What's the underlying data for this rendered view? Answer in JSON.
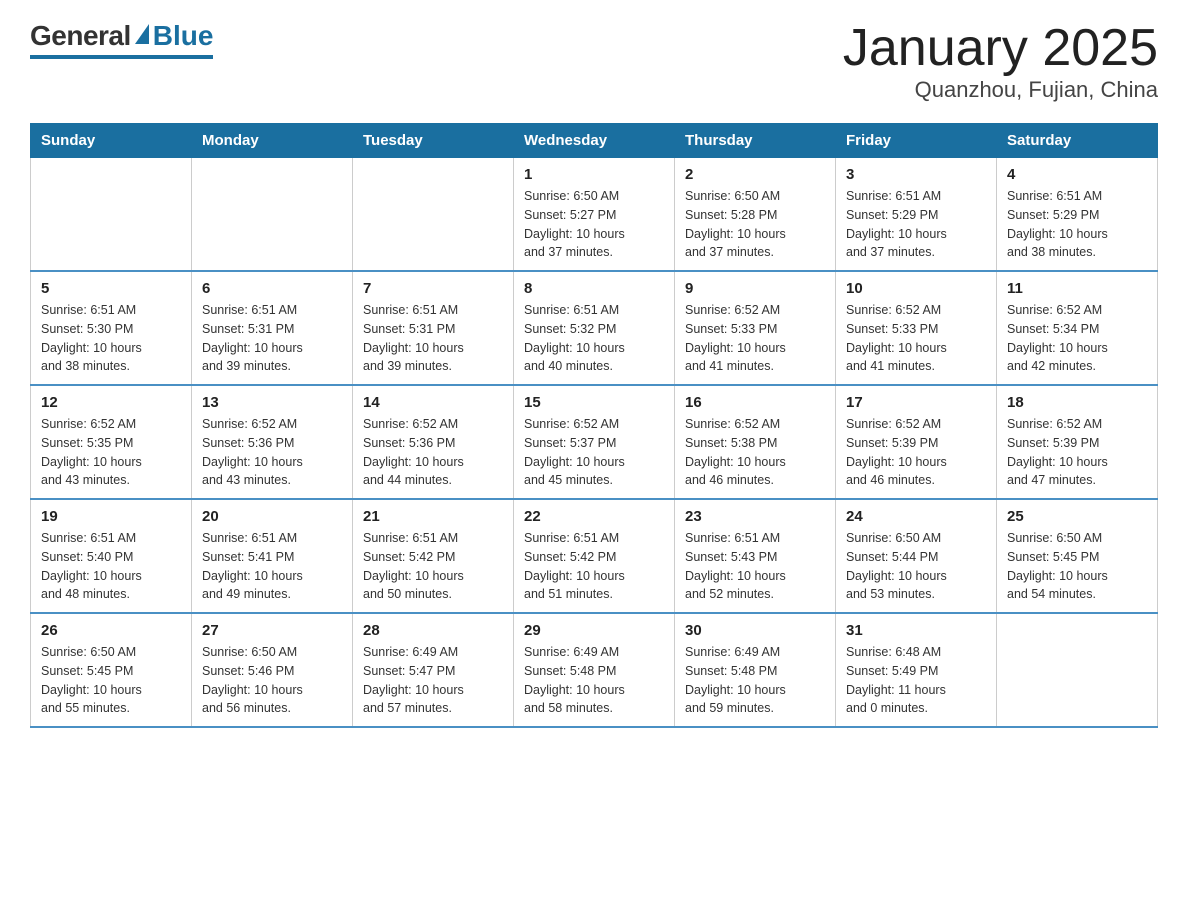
{
  "logo": {
    "general": "General",
    "blue": "Blue",
    "subtitle": "Blue"
  },
  "title": "January 2025",
  "location": "Quanzhou, Fujian, China",
  "weekdays": [
    "Sunday",
    "Monday",
    "Tuesday",
    "Wednesday",
    "Thursday",
    "Friday",
    "Saturday"
  ],
  "weeks": [
    [
      {
        "day": "",
        "info": ""
      },
      {
        "day": "",
        "info": ""
      },
      {
        "day": "",
        "info": ""
      },
      {
        "day": "1",
        "info": "Sunrise: 6:50 AM\nSunset: 5:27 PM\nDaylight: 10 hours\nand 37 minutes."
      },
      {
        "day": "2",
        "info": "Sunrise: 6:50 AM\nSunset: 5:28 PM\nDaylight: 10 hours\nand 37 minutes."
      },
      {
        "day": "3",
        "info": "Sunrise: 6:51 AM\nSunset: 5:29 PM\nDaylight: 10 hours\nand 37 minutes."
      },
      {
        "day": "4",
        "info": "Sunrise: 6:51 AM\nSunset: 5:29 PM\nDaylight: 10 hours\nand 38 minutes."
      }
    ],
    [
      {
        "day": "5",
        "info": "Sunrise: 6:51 AM\nSunset: 5:30 PM\nDaylight: 10 hours\nand 38 minutes."
      },
      {
        "day": "6",
        "info": "Sunrise: 6:51 AM\nSunset: 5:31 PM\nDaylight: 10 hours\nand 39 minutes."
      },
      {
        "day": "7",
        "info": "Sunrise: 6:51 AM\nSunset: 5:31 PM\nDaylight: 10 hours\nand 39 minutes."
      },
      {
        "day": "8",
        "info": "Sunrise: 6:51 AM\nSunset: 5:32 PM\nDaylight: 10 hours\nand 40 minutes."
      },
      {
        "day": "9",
        "info": "Sunrise: 6:52 AM\nSunset: 5:33 PM\nDaylight: 10 hours\nand 41 minutes."
      },
      {
        "day": "10",
        "info": "Sunrise: 6:52 AM\nSunset: 5:33 PM\nDaylight: 10 hours\nand 41 minutes."
      },
      {
        "day": "11",
        "info": "Sunrise: 6:52 AM\nSunset: 5:34 PM\nDaylight: 10 hours\nand 42 minutes."
      }
    ],
    [
      {
        "day": "12",
        "info": "Sunrise: 6:52 AM\nSunset: 5:35 PM\nDaylight: 10 hours\nand 43 minutes."
      },
      {
        "day": "13",
        "info": "Sunrise: 6:52 AM\nSunset: 5:36 PM\nDaylight: 10 hours\nand 43 minutes."
      },
      {
        "day": "14",
        "info": "Sunrise: 6:52 AM\nSunset: 5:36 PM\nDaylight: 10 hours\nand 44 minutes."
      },
      {
        "day": "15",
        "info": "Sunrise: 6:52 AM\nSunset: 5:37 PM\nDaylight: 10 hours\nand 45 minutes."
      },
      {
        "day": "16",
        "info": "Sunrise: 6:52 AM\nSunset: 5:38 PM\nDaylight: 10 hours\nand 46 minutes."
      },
      {
        "day": "17",
        "info": "Sunrise: 6:52 AM\nSunset: 5:39 PM\nDaylight: 10 hours\nand 46 minutes."
      },
      {
        "day": "18",
        "info": "Sunrise: 6:52 AM\nSunset: 5:39 PM\nDaylight: 10 hours\nand 47 minutes."
      }
    ],
    [
      {
        "day": "19",
        "info": "Sunrise: 6:51 AM\nSunset: 5:40 PM\nDaylight: 10 hours\nand 48 minutes."
      },
      {
        "day": "20",
        "info": "Sunrise: 6:51 AM\nSunset: 5:41 PM\nDaylight: 10 hours\nand 49 minutes."
      },
      {
        "day": "21",
        "info": "Sunrise: 6:51 AM\nSunset: 5:42 PM\nDaylight: 10 hours\nand 50 minutes."
      },
      {
        "day": "22",
        "info": "Sunrise: 6:51 AM\nSunset: 5:42 PM\nDaylight: 10 hours\nand 51 minutes."
      },
      {
        "day": "23",
        "info": "Sunrise: 6:51 AM\nSunset: 5:43 PM\nDaylight: 10 hours\nand 52 minutes."
      },
      {
        "day": "24",
        "info": "Sunrise: 6:50 AM\nSunset: 5:44 PM\nDaylight: 10 hours\nand 53 minutes."
      },
      {
        "day": "25",
        "info": "Sunrise: 6:50 AM\nSunset: 5:45 PM\nDaylight: 10 hours\nand 54 minutes."
      }
    ],
    [
      {
        "day": "26",
        "info": "Sunrise: 6:50 AM\nSunset: 5:45 PM\nDaylight: 10 hours\nand 55 minutes."
      },
      {
        "day": "27",
        "info": "Sunrise: 6:50 AM\nSunset: 5:46 PM\nDaylight: 10 hours\nand 56 minutes."
      },
      {
        "day": "28",
        "info": "Sunrise: 6:49 AM\nSunset: 5:47 PM\nDaylight: 10 hours\nand 57 minutes."
      },
      {
        "day": "29",
        "info": "Sunrise: 6:49 AM\nSunset: 5:48 PM\nDaylight: 10 hours\nand 58 minutes."
      },
      {
        "day": "30",
        "info": "Sunrise: 6:49 AM\nSunset: 5:48 PM\nDaylight: 10 hours\nand 59 minutes."
      },
      {
        "day": "31",
        "info": "Sunrise: 6:48 AM\nSunset: 5:49 PM\nDaylight: 11 hours\nand 0 minutes."
      },
      {
        "day": "",
        "info": ""
      }
    ]
  ]
}
